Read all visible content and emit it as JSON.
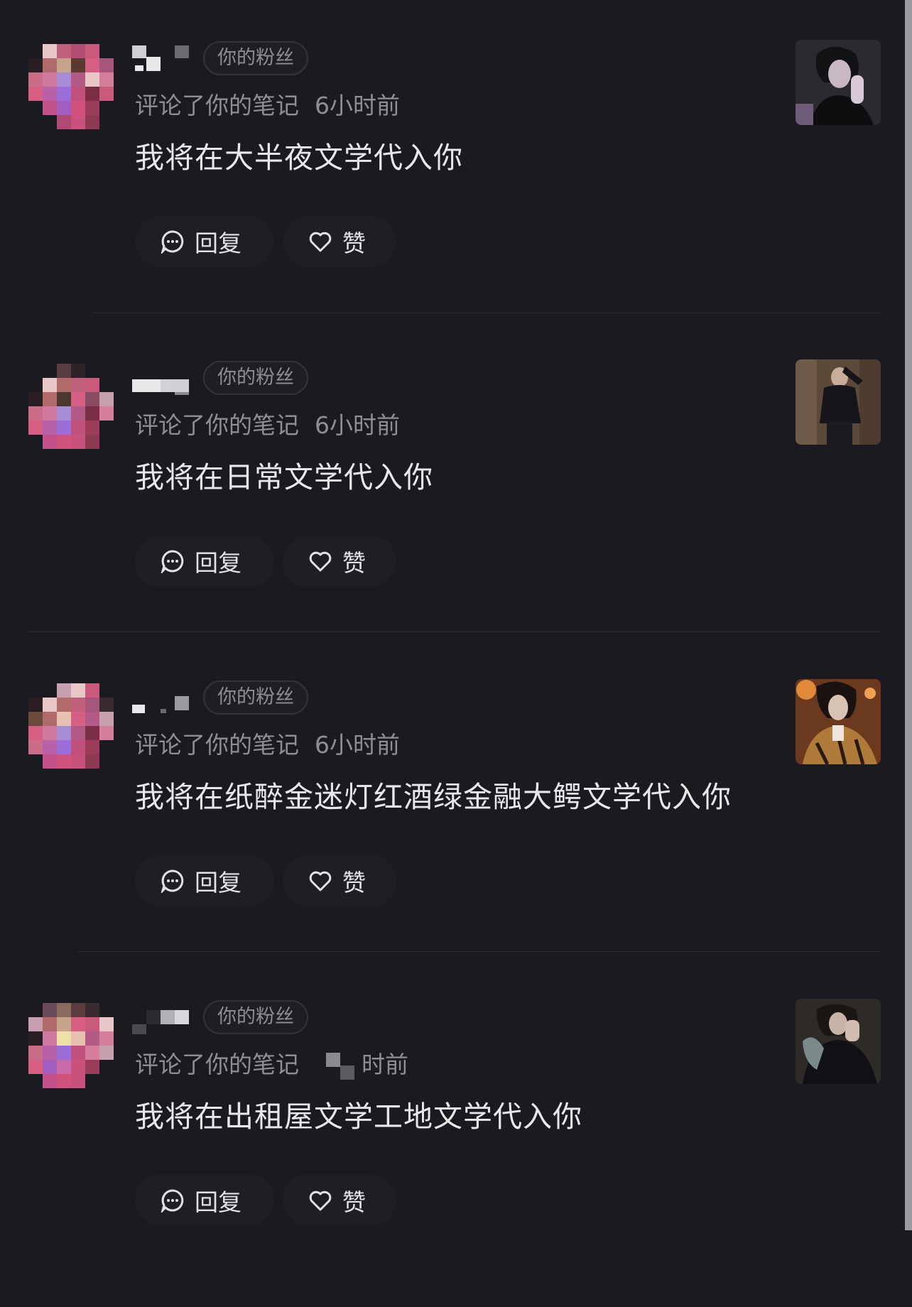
{
  "comments": [
    {
      "badge": "你的粉丝",
      "action": "评论了你的笔记",
      "time": "6小时前",
      "content": "我将在大半夜文学代入你",
      "reply_label": "回复",
      "like_label": "赞",
      "thumb_desc": "dark-photo"
    },
    {
      "badge": "你的粉丝",
      "action": "评论了你的笔记",
      "time": "6小时前",
      "content": "我将在日常文学代入你",
      "reply_label": "回复",
      "like_label": "赞",
      "thumb_desc": "dark-photo"
    },
    {
      "badge": "你的粉丝",
      "action": "评论了你的笔记",
      "time": "6小时前",
      "content": "我将在纸醉金迷灯红酒绿金融大鳄文学代入你",
      "reply_label": "回复",
      "like_label": "赞",
      "thumb_desc": "warm-photo"
    },
    {
      "badge": "你的粉丝",
      "action": "评论了你的笔记",
      "time": "时前",
      "content": "我将在出租屋文学工地文学代入你",
      "reply_label": "回复",
      "like_label": "赞",
      "thumb_desc": "dark-photo"
    }
  ],
  "colors": {
    "background": "#1b1a20",
    "muted_text": "#8f8e96",
    "button_bg": "#1f1e24"
  },
  "icons": {
    "reply": "comment-bubble-icon",
    "like": "heart-outline-icon"
  }
}
